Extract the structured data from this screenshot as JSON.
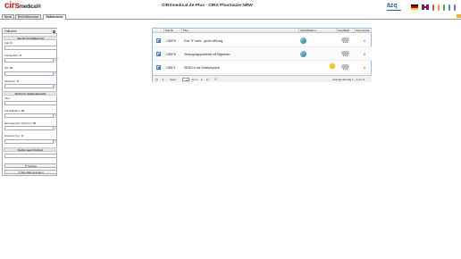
{
  "header": {
    "logo_main": "cirs",
    "logo_sub": "medical",
    "logo_reg": "®",
    "app_title": "CIRSmedical.de-Plus - CIRS Pharmazie NRW",
    "partner_logo": "äzq",
    "flags": [
      "flag-de-icon",
      "flag-en-icon"
    ]
  },
  "tabs": [
    {
      "label": "News",
      "active": false
    },
    {
      "label": "Berichtformular",
      "active": false
    },
    {
      "label": "Fallberichte",
      "active": true
    }
  ],
  "sidebar": {
    "title": "Fallsuche",
    "section1": "Suche im Fallbericht",
    "fallnr_label": "Fall-Nr:",
    "fachgebiet_label": "Fachgebiet:",
    "wo_label": "Wo:",
    "wodurch_label": "Wodurch:",
    "section2": "Suche in Analysebericht",
    "titel_label": "Titel:",
    "klassifikation_label": "Klassifikation:",
    "beitragenden_label": "Beitragenden Faktoren:",
    "ereignistyp_label": "Ereignis-Typ:",
    "section3": "Suche nach Freitext",
    "search_button": "Suchen",
    "show_all_button": "Alle Fälle anzeigen"
  },
  "grid": {
    "columns": [
      "Fall-Nr",
      "Titel",
      "Klassifikation",
      "Feedback",
      "Kommentar"
    ],
    "rows": [
      {
        "nr": "135578",
        "titel": "Eine \"5\" mehr - große Wirkung",
        "klassifikation": "globe-icon",
        "feedback": "cloud-icon",
        "kommentare": "0"
      },
      {
        "nr": "135576",
        "titel": "Versorgungsprobleme mit Migranten",
        "klassifikation": "globe-icon",
        "feedback": "cloud-icon",
        "kommentare": "0"
      },
      {
        "nr": "135571",
        "titel": "SENDI in der Erkältungszeit",
        "klassifikation": "sun-icon",
        "feedback": "cloud-icon",
        "kommentare": "0"
      }
    ],
    "pager": {
      "page_label": "Seite",
      "page_value": "1",
      "of_label": "von 1",
      "display_info": "Anzeige Eintrag 1 - 3 von 3"
    }
  }
}
